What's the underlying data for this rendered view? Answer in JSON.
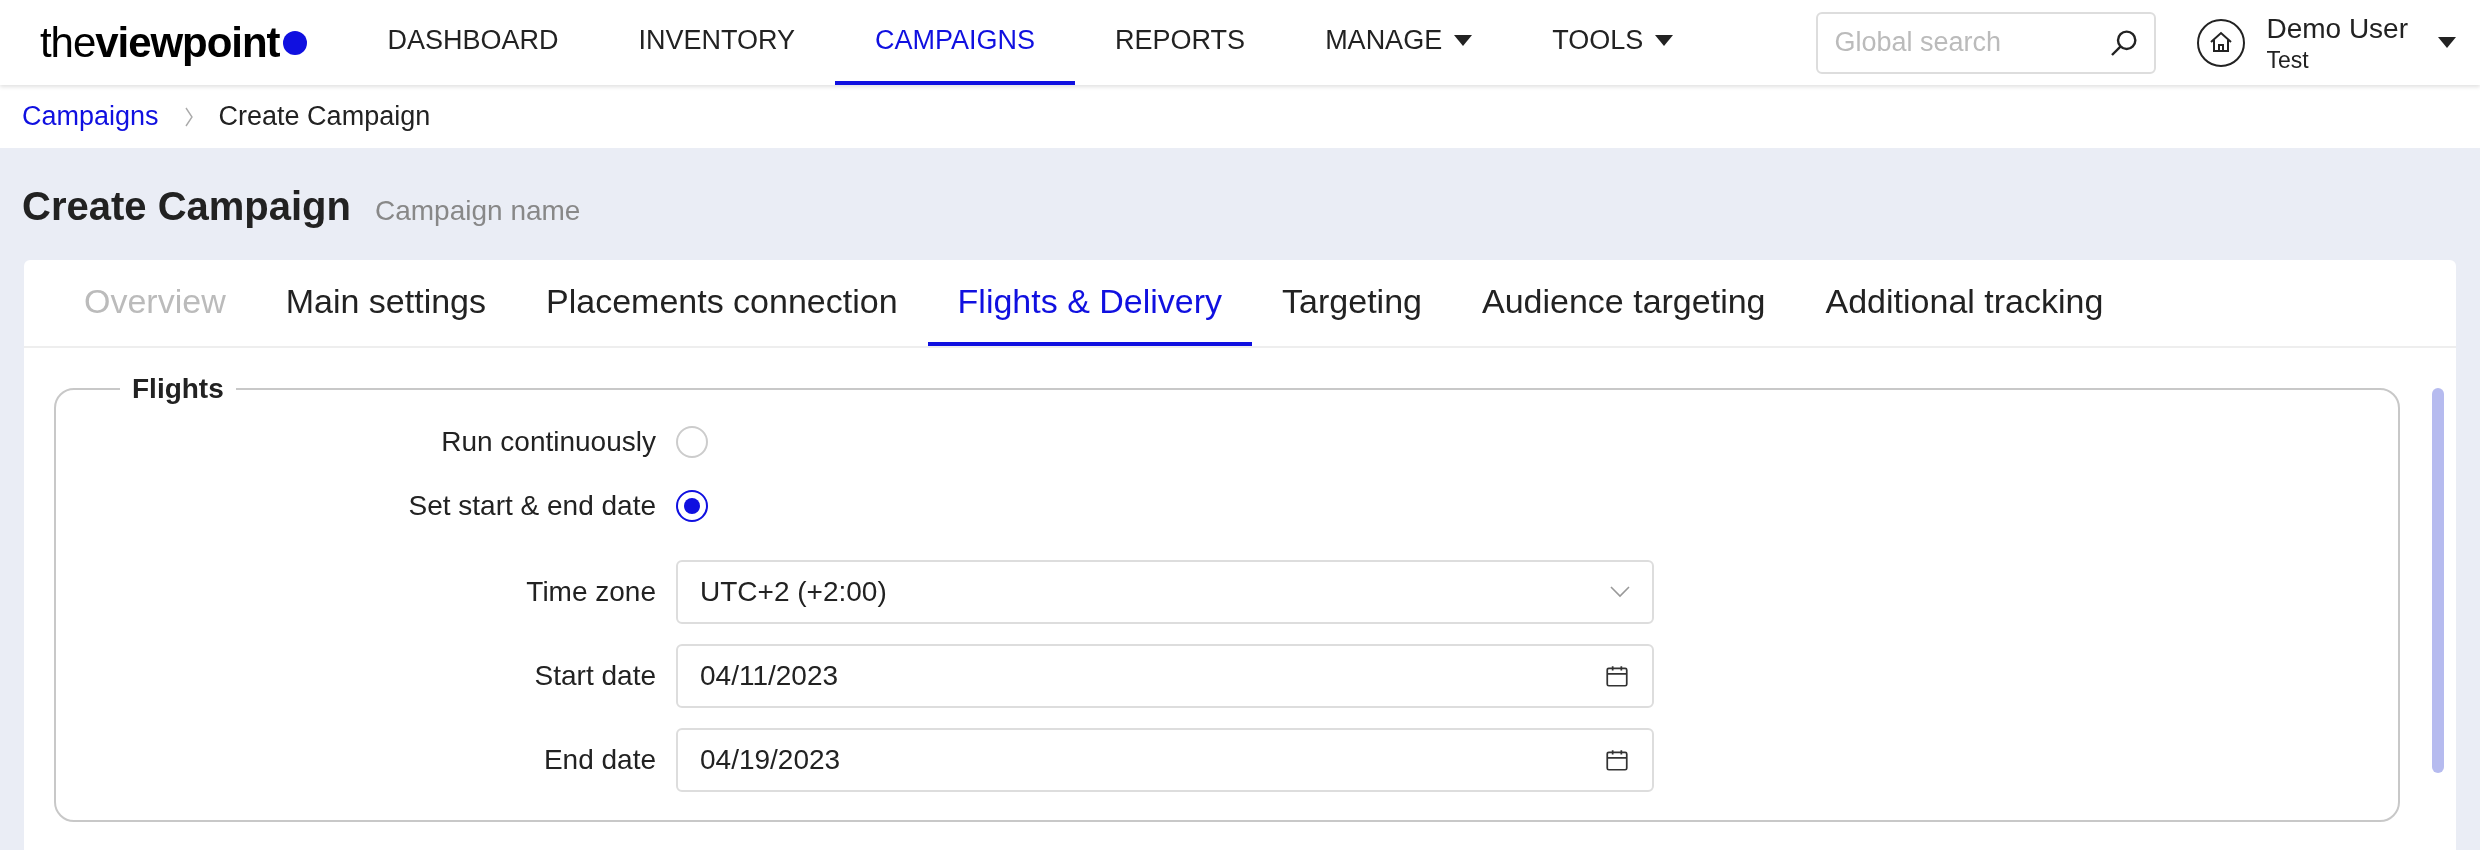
{
  "logo": {
    "text": "the**viewpoint**"
  },
  "nav": [
    {
      "label": "DASHBOARD",
      "selected": false,
      "has_menu": false
    },
    {
      "label": "INVENTORY",
      "selected": false,
      "has_menu": false
    },
    {
      "label": "CAMPAIGNS",
      "selected": true,
      "has_menu": false
    },
    {
      "label": "REPORTS",
      "selected": false,
      "has_menu": false
    },
    {
      "label": "MANAGE",
      "selected": false,
      "has_menu": true
    },
    {
      "label": "TOOLS",
      "selected": false,
      "has_menu": true
    }
  ],
  "search": {
    "placeholder": "Global search"
  },
  "user": {
    "name": "Demo User",
    "account": "Test"
  },
  "breadcrumb": [
    {
      "label": "Campaigns",
      "kind": "link"
    },
    {
      "label": "Create Campaign",
      "kind": "current"
    }
  ],
  "page": {
    "title": "Create Campaign",
    "subtitle": "Campaign name"
  },
  "tabs": [
    {
      "label": "Overview",
      "selected": false,
      "disabled": true
    },
    {
      "label": "Main settings",
      "selected": false,
      "disabled": false
    },
    {
      "label": "Placements connection",
      "selected": false,
      "disabled": false
    },
    {
      "label": "Flights & Delivery",
      "selected": true,
      "disabled": false
    },
    {
      "label": "Targeting",
      "selected": false,
      "disabled": false
    },
    {
      "label": "Audience targeting",
      "selected": false,
      "disabled": false
    },
    {
      "label": "Additional tracking",
      "selected": false,
      "disabled": false
    }
  ],
  "flights": {
    "legend": "Flights",
    "options": [
      {
        "label": "Run continuously",
        "selected": false
      },
      {
        "label": "Set start & end date",
        "selected": true
      }
    ],
    "fields": [
      {
        "label": "Time zone",
        "value": "UTC+2 (+2:00)",
        "kind": "select"
      },
      {
        "label": "Start date",
        "value": "04/11/2023",
        "kind": "date"
      },
      {
        "label": "End date",
        "value": "04/19/2023",
        "kind": "date"
      }
    ]
  }
}
